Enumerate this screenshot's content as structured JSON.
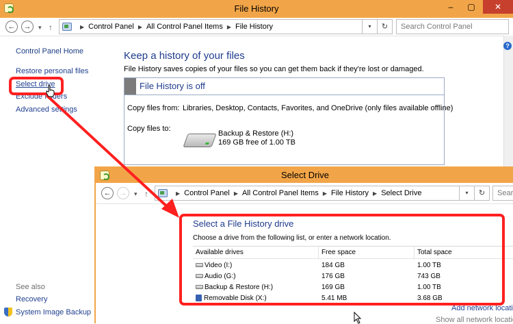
{
  "main_window": {
    "title": "File History",
    "controls": {
      "minimize": "–",
      "maximize": "▢",
      "close": "✕"
    },
    "breadcrumbs": [
      "Control Panel",
      "All Control Panel Items",
      "File History"
    ],
    "search_placeholder": "Search Control Panel",
    "sidebar": {
      "home": "Control Panel Home",
      "links": [
        "Restore personal files",
        "Select drive",
        "Exclude folders",
        "Advanced settings"
      ],
      "see_also_heading": "See also",
      "see_also": [
        "Recovery",
        "System Image Backup"
      ]
    },
    "heading": "Keep a history of your files",
    "description": "File History saves copies of your files so you can get them back if they're lost or damaged.",
    "status": "File History is off",
    "copy_from_label": "Copy files from:",
    "copy_from_value": "Libraries, Desktop, Contacts, Favorites, and OneDrive (only files available offline)",
    "copy_to_label": "Copy files to:",
    "drive_name": "Backup & Restore (H:)",
    "drive_space": "169 GB free of 1.00 TB"
  },
  "dialog": {
    "title": "Select Drive",
    "breadcrumbs": [
      "Control Panel",
      "All Control Panel Items",
      "File History",
      "Select Drive"
    ],
    "search_placeholder": "Searc",
    "heading": "Select a File History drive",
    "description": "Choose a drive from the following list, or enter a network location.",
    "columns": [
      "Available drives",
      "Free space",
      "Total space"
    ],
    "drives": [
      {
        "name": "Video (I:)",
        "free": "184 GB",
        "total": "1.00 TB",
        "icon": "hard-drive-icon"
      },
      {
        "name": "Audio (G:)",
        "free": "176 GB",
        "total": "743 GB",
        "icon": "hard-drive-icon"
      },
      {
        "name": "Backup & Restore (H:)",
        "free": "169 GB",
        "total": "1.00 TB",
        "icon": "hard-drive-icon"
      },
      {
        "name": "Removable Disk (X:)",
        "free": "5.41 MB",
        "total": "3.68 GB",
        "icon": "usb-drive-icon"
      }
    ],
    "add_network": "Add network location",
    "show_network": "Show all network locations"
  },
  "colors": {
    "titlebar": "#f2a548",
    "link": "#1f3f8f",
    "heading": "#1e3b8c",
    "annotation": "#ff2020"
  }
}
